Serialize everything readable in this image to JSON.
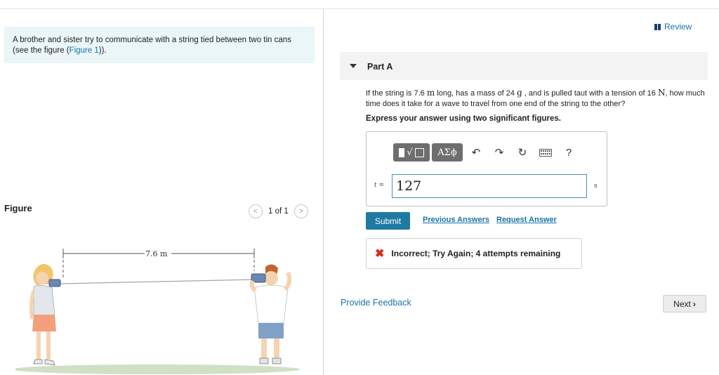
{
  "intro": {
    "text": "A brother and sister try to communicate with a string tied between two tin cans (see the figure (",
    "link": "Figure 1",
    "text_end": "))."
  },
  "figure_panel": {
    "heading": "Figure",
    "pager": "1 of 1",
    "prev_icon": "chevron-left-icon",
    "next_icon": "chevron-right-icon",
    "length_label": "7.6 m"
  },
  "review": {
    "label": "Review",
    "icon": "review-bars-icon"
  },
  "part": {
    "title": "Part A",
    "q_1": "If the string is 7.6 ",
    "q_unit_m": "m",
    "q_2": " long, has a mass of 24 ",
    "q_unit_g": "g",
    "q_3": " , and is pulled taut with a tension of 16 ",
    "q_unit_N": "N",
    "q_4": ", how much time does it take for a wave to travel from one end of the string to the other?",
    "instruction": "Express your answer using two significant figures."
  },
  "toolbar": {
    "templates_icon": "radical-template-icon",
    "greek_label": "ΑΣϕ",
    "undo_icon": "undo-icon",
    "redo_icon": "redo-icon",
    "reset_icon": "reset-icon",
    "keyboard_icon": "keyboard-icon",
    "help_label": "?"
  },
  "answer": {
    "var_label": "t =",
    "value": "127",
    "unit": "s"
  },
  "actions": {
    "submit": "Submit",
    "previous_answers": "Previous Answers",
    "request_answer": "Request Answer"
  },
  "feedback": {
    "mark": "✖",
    "message": "Incorrect; Try Again; 4 attempts remaining"
  },
  "footer": {
    "provide_feedback": "Provide Feedback",
    "next": "Next"
  },
  "colors": {
    "accent": "#1a73a8",
    "submit_bg": "#1e7aa3",
    "error": "#d62a1d",
    "intro_bg": "#eaf6f8"
  }
}
